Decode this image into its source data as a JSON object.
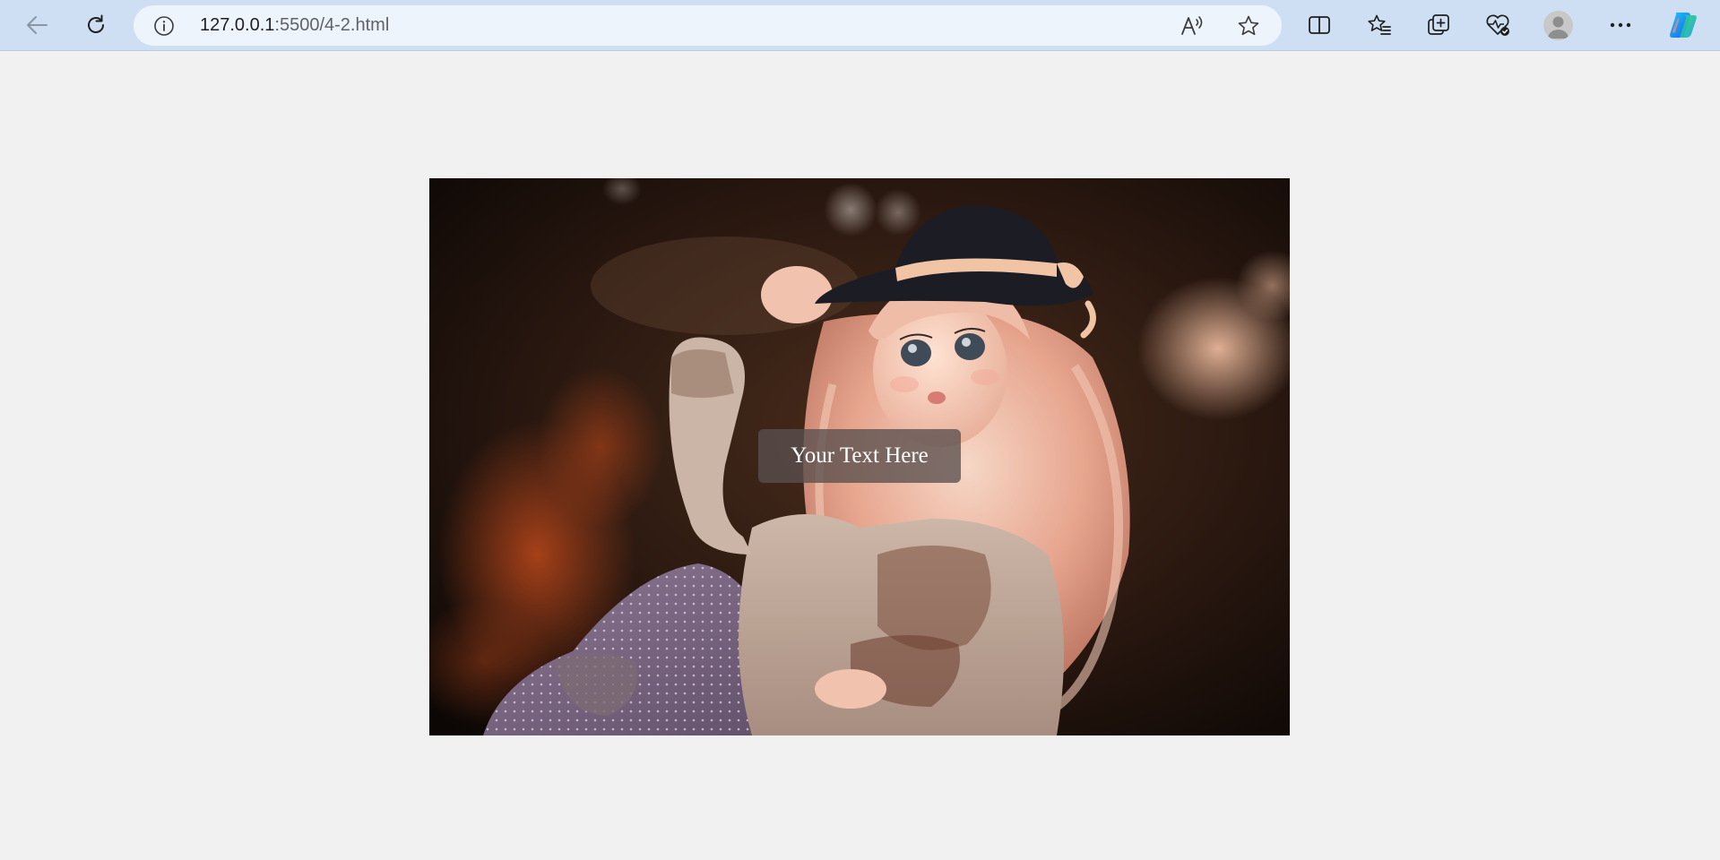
{
  "browser": {
    "address_bar": {
      "host": "127.0.0.1",
      "rest": ":5500/4-2.html"
    },
    "icons": {
      "back": "back-arrow-icon",
      "reload": "reload-icon",
      "site_info": "info-icon",
      "read_aloud": "read-aloud-icon",
      "favorite": "star-icon",
      "split_screen": "split-screen-icon",
      "favorites": "favorites-list-icon",
      "collections": "collections-icon",
      "browser_essentials": "heart-pulse-icon",
      "profile": "profile-avatar-icon",
      "menu": "more-options-icon",
      "copilot": "copilot-icon"
    }
  },
  "page": {
    "image": {
      "subject": "doll-photo"
    },
    "overlay_text": "Your Text Here"
  },
  "colors": {
    "toolbar_bg": "#cfdff3",
    "address_bg": "#eef4fc",
    "page_bg": "#f1f1f1",
    "caption_bg": "#5a504e",
    "caption_text": "#ffffff"
  }
}
